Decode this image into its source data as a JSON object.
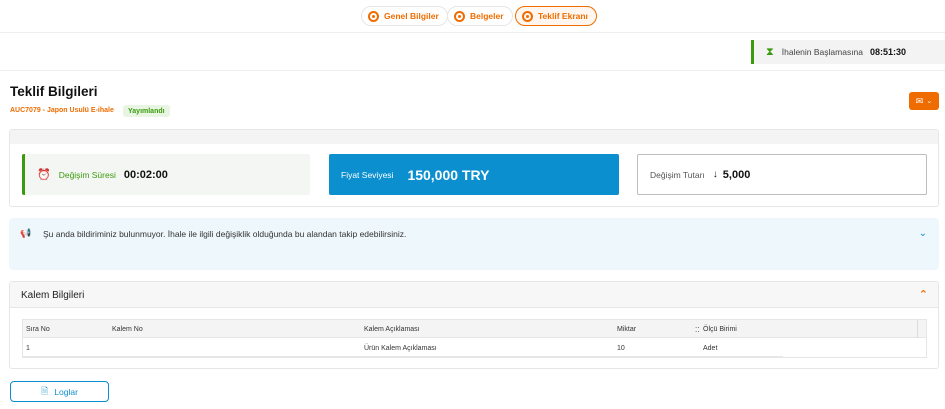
{
  "steps": [
    {
      "label": "Genel Bilgiler"
    },
    {
      "label": "Belgeler"
    },
    {
      "label": "Teklif Ekranı"
    }
  ],
  "countdown": {
    "label": "İhalenin Başlamasına",
    "value": "08:51:30"
  },
  "header": {
    "title": "Teklif Bilgileri",
    "code": "AUC7079 - Japon Usulü E-ihale",
    "status": "Yayımlandı"
  },
  "cards": {
    "change_period": {
      "label": "Değişim Süresi",
      "value": "00:02:00"
    },
    "price_level": {
      "label": "Fiyat Seviyesi",
      "value": "150,000 TRY"
    },
    "change_amount": {
      "label": "Değişim Tutarı",
      "arrow": "↓",
      "value": "5,000"
    }
  },
  "notice": {
    "text": "Şu anda bildiriminiz bulunmuyor. İhale ile ilgili değişiklik olduğunda bu alandan takip edebilirsiniz."
  },
  "items": {
    "title": "Kalem Bilgileri",
    "columns": [
      "Sıra No",
      "Kalem No",
      "Kalem Açıklaması",
      "Miktar",
      "Ölçü Birimi"
    ],
    "sort_glyph": "⁚⁚",
    "rows": [
      [
        "1",
        "",
        "Ürün Kalem Açıklaması",
        "10",
        "Adet"
      ]
    ]
  },
  "buttons": {
    "logs": "Loglar"
  },
  "colors": {
    "accent": "#ef6c00",
    "primary": "#0b8fcf",
    "success": "#3a9b0e"
  }
}
